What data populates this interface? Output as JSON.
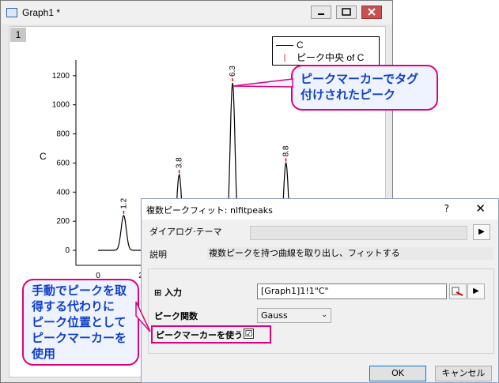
{
  "graph_window": {
    "title": "Graph1 *",
    "layer_number": "1",
    "legend": {
      "line_entry": "C",
      "marker_entry": "ピーク中央 of C"
    },
    "buttons": {
      "minimize": "minimize-icon",
      "maximize": "maximize-icon",
      "close": "close-icon"
    }
  },
  "chart_data": {
    "type": "line",
    "ylabel": "C",
    "yticks": [
      "0",
      "200",
      "400",
      "600",
      "800",
      "1000",
      "1200"
    ],
    "xticks": [
      "0",
      "2"
    ],
    "peak_labels": [
      "1.2",
      "3.8",
      "6.3",
      "8.8"
    ]
  },
  "callouts": {
    "peak_marker": [
      "ピークマーカーでタグ",
      "付けされたピーク"
    ],
    "manual": [
      "手動でピークを取",
      "得する代わりに",
      "ピーク位置として",
      "ピークマーカーを",
      "使用"
    ]
  },
  "dialog": {
    "title": "複数ピークフィット: nlfitpeaks",
    "help": "?",
    "close": "✕",
    "theme_label": "ダイアログ·テーマ",
    "description_label": "説明",
    "description_text": "複数ピークを持つ曲線を取り出し、フィットする",
    "input_label": "入力",
    "expand_icon": "⊞",
    "input_value": "[Graph1]1!1\"C\"",
    "peak_function_label": "ピーク関数",
    "peak_function_value": "Gauss",
    "use_peak_marker_label": "ピークマーカーを使う",
    "use_peak_marker_checked": "☑",
    "ok_label": "OK",
    "cancel_label": "キャンセル"
  }
}
